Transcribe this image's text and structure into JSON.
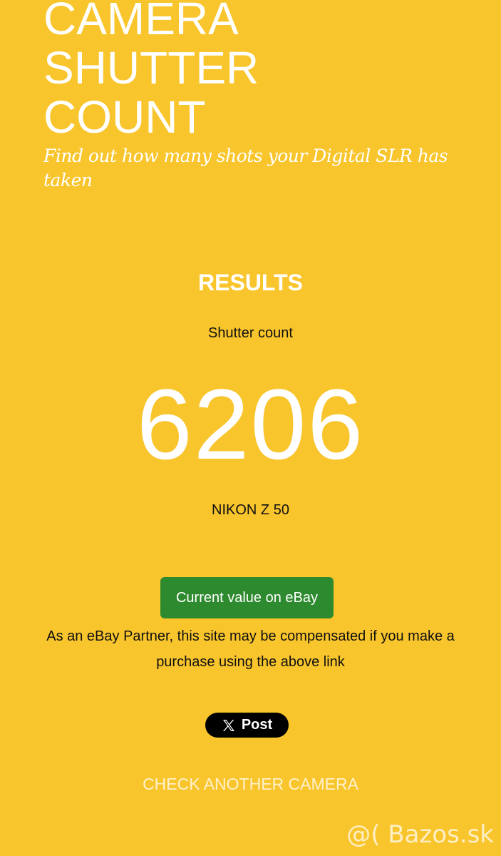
{
  "header": {
    "title_line1": "CAMERA",
    "title_line2": "SHUTTER",
    "title_line3": "COUNT",
    "subtitle": "Find out how many shots your Digital SLR has taken"
  },
  "results": {
    "heading": "RESULTS",
    "label": "Shutter count",
    "count": "6206",
    "camera_model": "NIKON Z 50"
  },
  "ebay": {
    "button_label": "Current value on eBay",
    "disclaimer": "As an eBay Partner, this site may be compensated if you make a purchase using the above link"
  },
  "share": {
    "post_label": "Post",
    "icon": "x-logo-icon"
  },
  "footer": {
    "check_another_label": "CHECK ANOTHER CAMERA"
  },
  "watermark": {
    "text": "@( Bazos.sk"
  },
  "colors": {
    "background": "#F9C52D",
    "ebay_button": "#2E8A2F",
    "post_button": "#000000",
    "text_primary": "#FFFFFF"
  }
}
